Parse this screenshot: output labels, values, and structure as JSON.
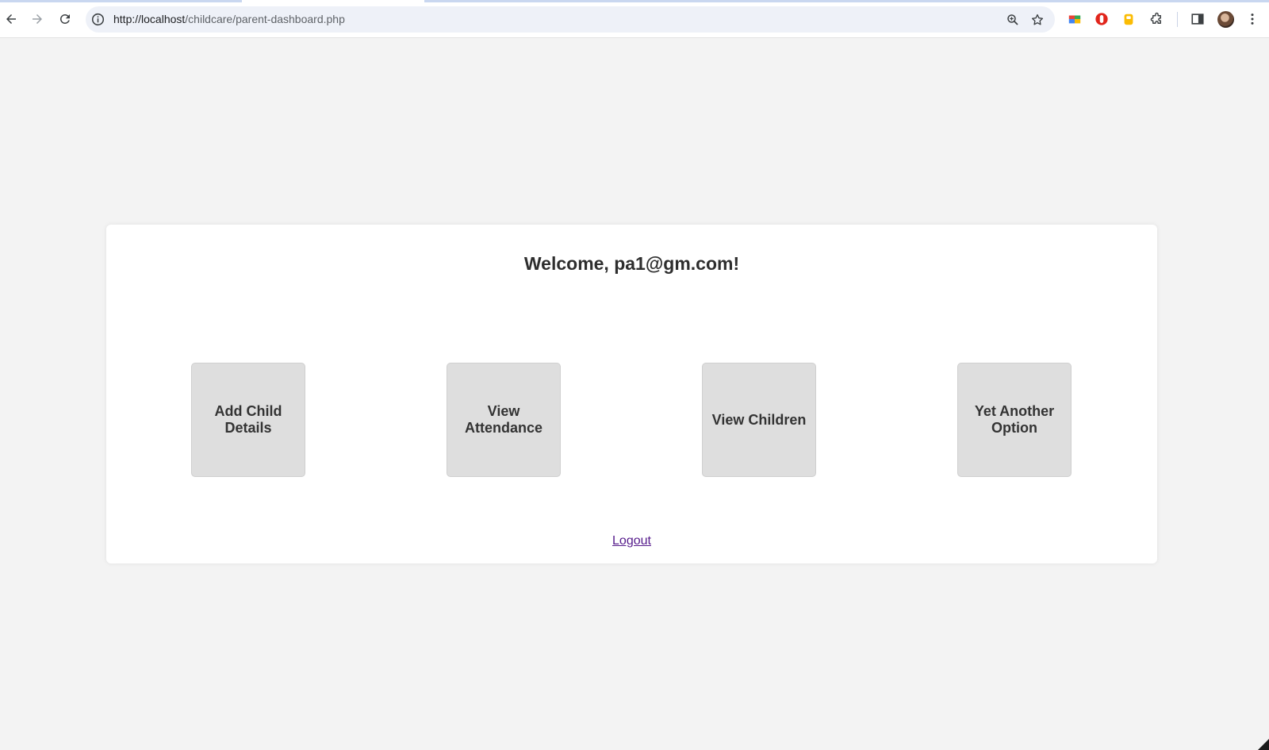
{
  "browser": {
    "url_host": "http://localhost",
    "url_path": "/childcare/parent-dashboard.php",
    "icons": {
      "back": "back-arrow-icon",
      "forward": "forward-arrow-icon",
      "reload": "reload-icon",
      "site_info": "info-icon",
      "zoom": "zoom-icon",
      "bookmark": "star-icon",
      "extensions": [
        "colorful-extension-icon",
        "red-shield-extension-icon",
        "yellow-extension-icon",
        "puzzle-icon"
      ],
      "side_panel": "side-panel-icon",
      "profile": "avatar",
      "menu": "kebab-menu-icon"
    }
  },
  "page": {
    "welcome": "Welcome, pa1@gm.com!",
    "tiles": [
      {
        "label": "Add Child Details"
      },
      {
        "label": "View Attendance"
      },
      {
        "label": "View Children"
      },
      {
        "label": "Yet Another Option"
      }
    ],
    "logout_label": "Logout"
  },
  "colors": {
    "page_background": "#f3f3f3",
    "card_background": "#ffffff",
    "tile_background": "#dedede",
    "link_visited": "#551a8b"
  }
}
